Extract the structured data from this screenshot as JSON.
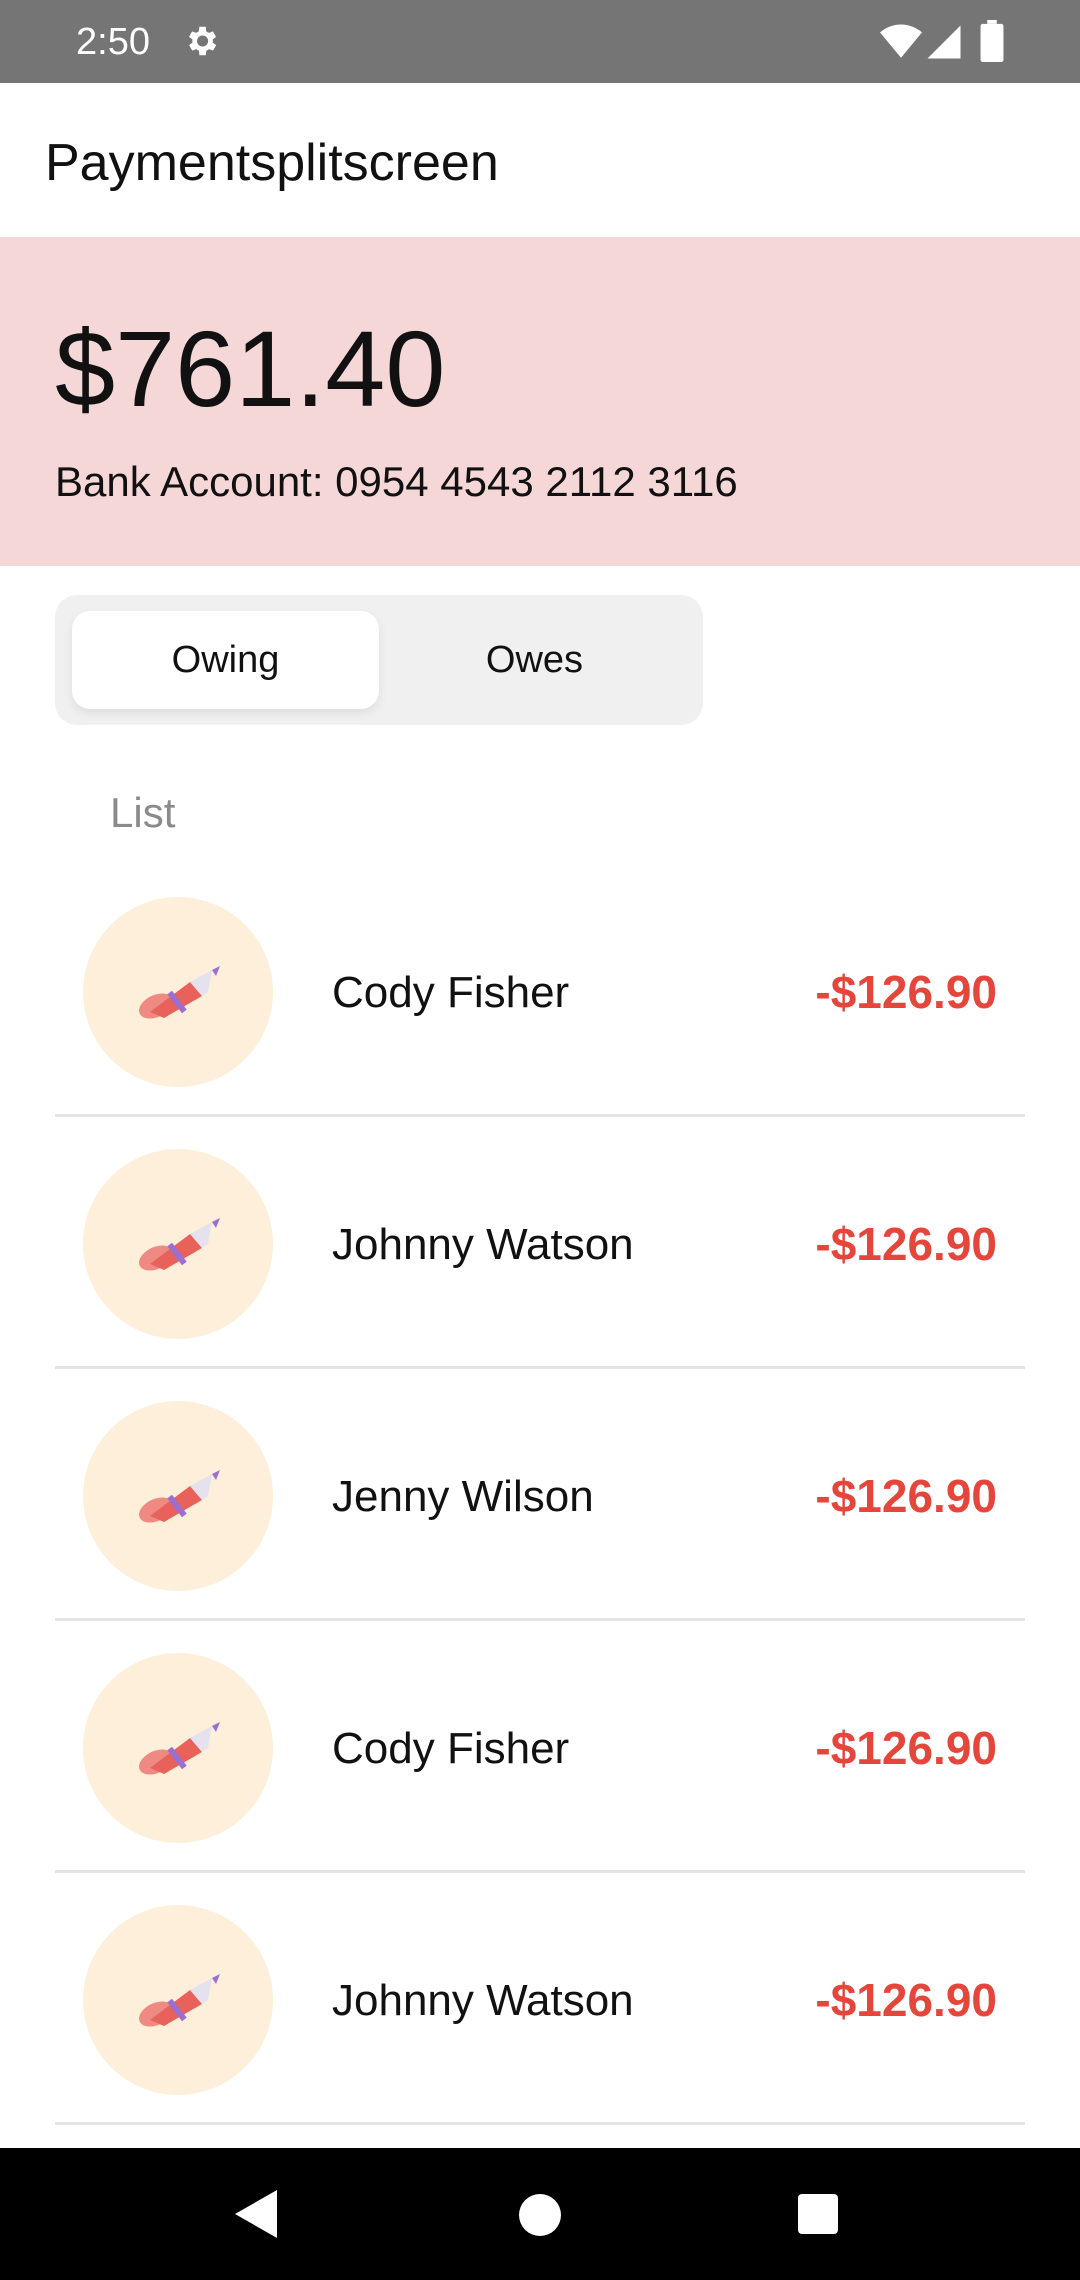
{
  "status_bar": {
    "time": "2:50",
    "icons": [
      "gear-icon",
      "wifi-icon",
      "signal-icon",
      "battery-icon"
    ]
  },
  "app_bar": {
    "title": "Paymentsplitscreen"
  },
  "balance": {
    "amount": "$761.40",
    "bank_account": "Bank Account: 0954 4543 2112 3116"
  },
  "tabs": {
    "owing": "Owing",
    "owes": "Owes",
    "selected": "Owing"
  },
  "list": {
    "header": "List",
    "items": [
      {
        "name": "Cody Fisher",
        "amount": "-$126.90"
      },
      {
        "name": "Johnny Watson",
        "amount": "-$126.90"
      },
      {
        "name": "Jenny Wilson",
        "amount": "-$126.90"
      },
      {
        "name": "Cody Fisher",
        "amount": "-$126.90"
      },
      {
        "name": "Johnny Watson",
        "amount": "-$126.90"
      }
    ]
  },
  "colors": {
    "status_bar": "#757575",
    "banner": "#f6d7d8",
    "negative_amount": "#e5463b",
    "avatar_bg": "#fdefd9",
    "segment_bg": "#f0f0f0"
  },
  "nav_bar": {
    "icons": [
      "back-icon",
      "home-icon",
      "recents-icon"
    ]
  }
}
